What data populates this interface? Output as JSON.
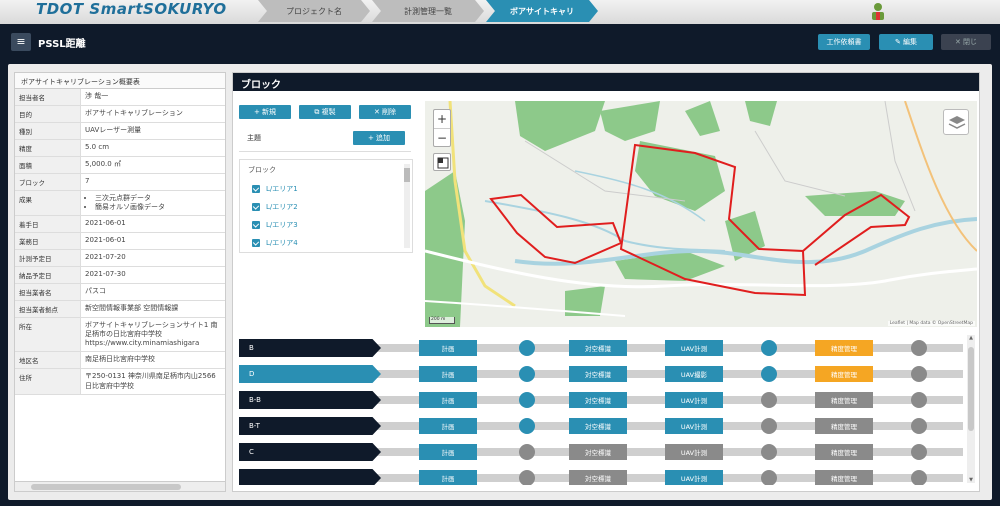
{
  "app": {
    "logo": "TDOT SmartSOKURYO"
  },
  "breadcrumbs": [
    "プロジェクト名",
    "計測管理一覧",
    "ボアサイトキャリ"
  ],
  "titlebar": {
    "title": "PSSL距離",
    "buttons": [
      {
        "label": "工作依頼書",
        "style": "teal"
      },
      {
        "label": "✎ 編集",
        "style": "teal"
      },
      {
        "label": "✕ 閉じ",
        "style": "grey"
      }
    ]
  },
  "detail": {
    "header": "ボアサイトキャリブレーション概要表",
    "rows": [
      {
        "key": "担当者名",
        "value": "渉 哉一"
      },
      {
        "key": "目的",
        "value": "ボアサイトキャリブレーション"
      },
      {
        "key": "種別",
        "value": "UAVレーザー測量"
      },
      {
        "key": "精度",
        "value": "5.0 cm"
      },
      {
        "key": "面積",
        "value": "5,000.0 ㎡"
      },
      {
        "key": "ブロック",
        "value": "7"
      },
      {
        "key": "成果",
        "value": "",
        "list": [
          "三次元点群データ",
          "簡易オルソ画像データ"
        ]
      },
      {
        "key": "着手日",
        "value": "2021-06-01"
      },
      {
        "key": "業務日",
        "value": "2021-06-01"
      },
      {
        "key": "計測予定日",
        "value": "2021-07-20"
      },
      {
        "key": "納品予定日",
        "value": "2021-07-30"
      },
      {
        "key": "担当業者名",
        "value": "パスコ"
      },
      {
        "key": "担当業者拠点",
        "value": "新空間情報事業部 空間情報課"
      },
      {
        "key": "所在",
        "value": "ボアサイトキャリブレーションサイト1 南足柄市の日比宮府中学校\nhttps://www.city.minamiashigara"
      },
      {
        "key": "地区名",
        "value": "南足柄日比宮府中学校"
      },
      {
        "key": "住所",
        "value": "〒250-0131 神奈川県南足柄市内山2566 日比宮府中学校"
      }
    ]
  },
  "block_panel": {
    "title": "ブロック",
    "actions": [
      {
        "label": "+ 新規"
      },
      {
        "label": "⧉ 複製"
      },
      {
        "label": "✕ 削除"
      }
    ],
    "theme_label": "主題",
    "add_label": "+ 追加",
    "list_title": "ブロック",
    "blocks": [
      "L/エリア1",
      "L/エリア2",
      "L/エリア3",
      "L/エリア4"
    ]
  },
  "map": {
    "zoom_in": "+",
    "zoom_out": "−",
    "scale": "200 m",
    "attribution": "Leaflet | Map data © OpenStreetMap",
    "colors": {
      "water": "#a9d3e0",
      "forest": "#8dc98a",
      "road": "#f1e27a",
      "boundary": "#e01e1e"
    }
  },
  "timeline": {
    "rows": [
      {
        "name": "B",
        "pill": "dark",
        "stages": [
          "teal",
          "teal",
          "teal",
          "teal",
          "teal",
          "orange",
          "grey"
        ]
      },
      {
        "name": "D",
        "pill": "teal",
        "stages": [
          "teal",
          "teal",
          "teal",
          "teal",
          "teal",
          "orange",
          "grey"
        ]
      },
      {
        "name": "B-B",
        "pill": "dark",
        "stages": [
          "teal",
          "teal",
          "teal",
          "teal",
          "grey",
          "grey",
          "grey"
        ]
      },
      {
        "name": "B-T",
        "pill": "dark",
        "stages": [
          "teal",
          "teal",
          "teal",
          "teal",
          "grey",
          "grey",
          "grey"
        ]
      },
      {
        "name": "C",
        "pill": "dark",
        "stages": [
          "teal",
          "grey",
          "grey",
          "grey",
          "grey",
          "grey",
          "grey"
        ]
      },
      {
        "name": "",
        "pill": "dark",
        "stages": [
          "teal",
          "grey",
          "grey",
          "teal",
          "grey",
          "grey",
          "grey"
        ]
      }
    ],
    "stage_labels": [
      "計画",
      "対空標識",
      "UAV計測",
      "精度管理"
    ],
    "stage_labels_alt": {
      "1": {
        "2": "UAV撮影"
      }
    }
  }
}
